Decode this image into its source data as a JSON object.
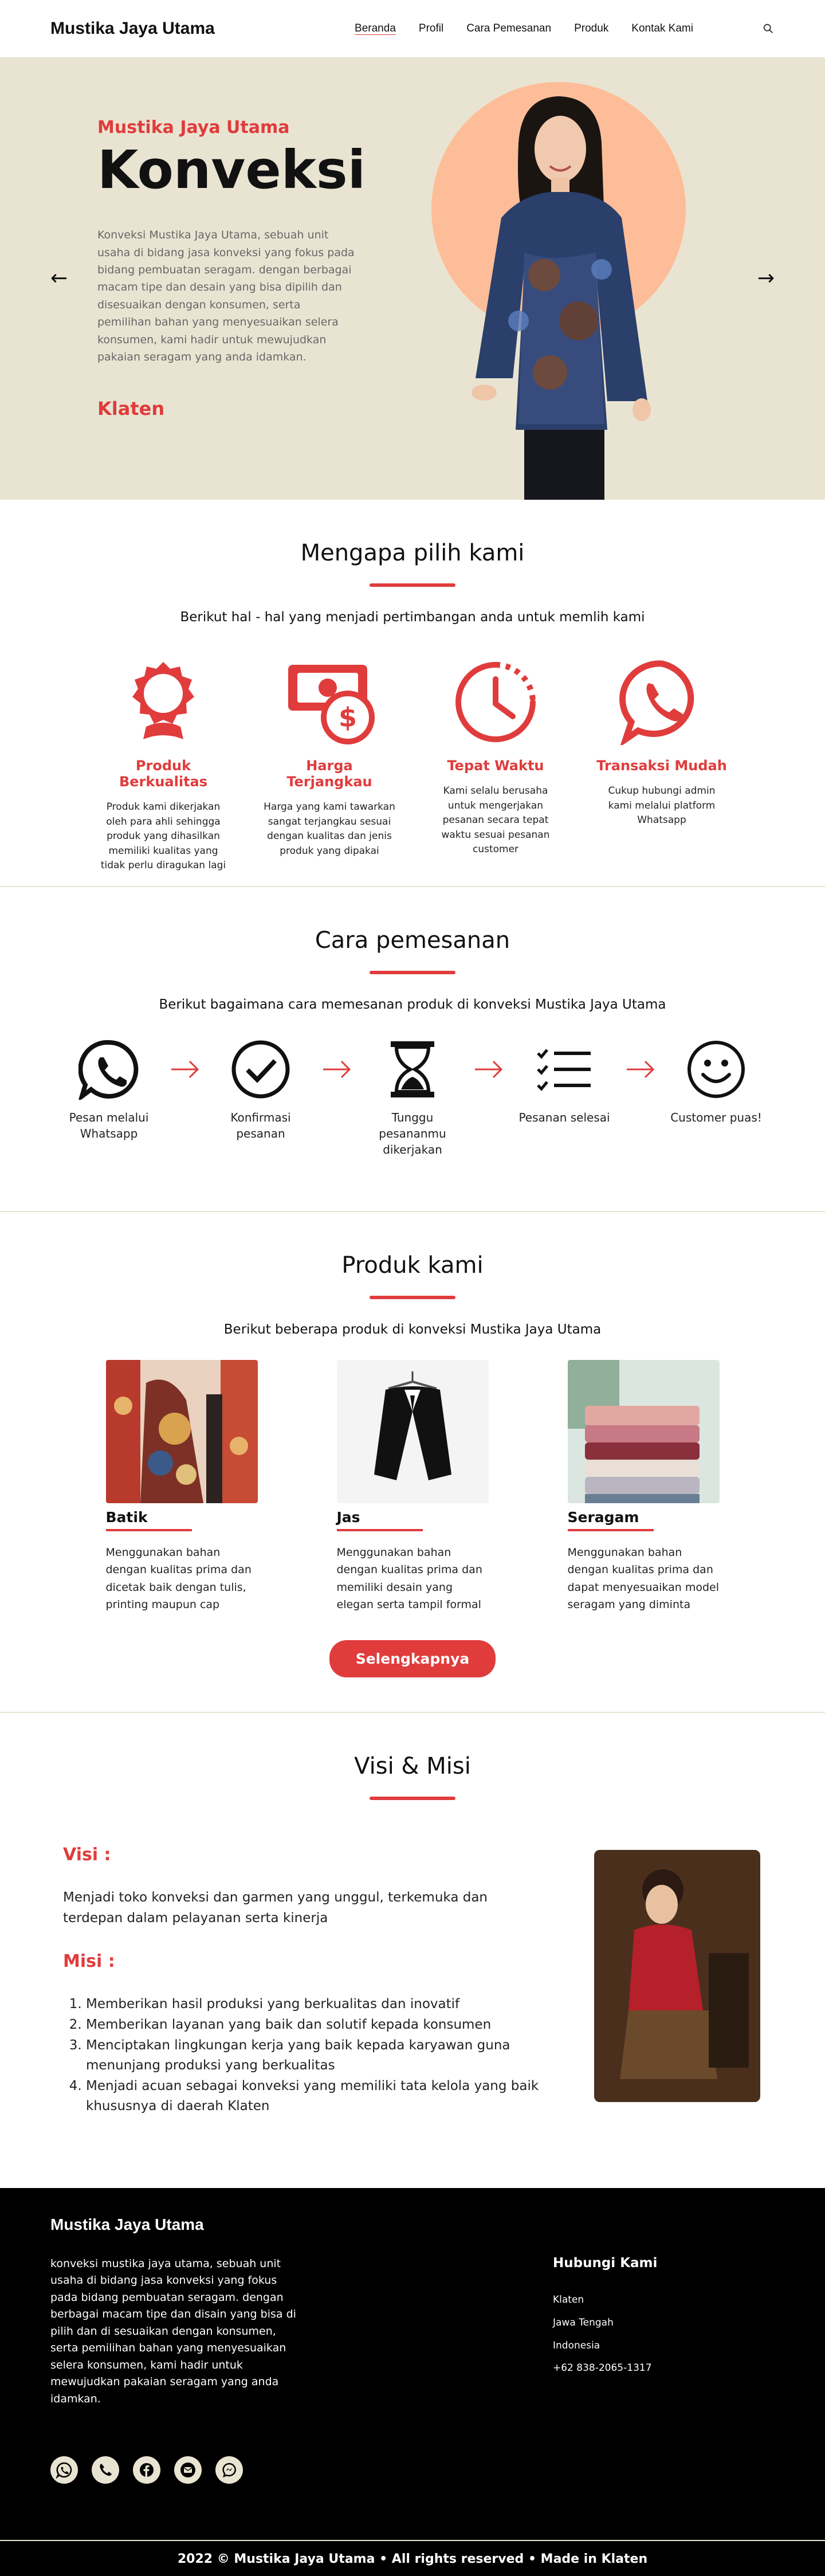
{
  "nav": {
    "brand": "Mustika Jaya Utama",
    "links": [
      "Beranda",
      "Profil",
      "Cara Pemesanan",
      "Produk",
      "Kontak Kami"
    ],
    "search_icon": "search-icon"
  },
  "hero": {
    "subtitle": "Mustika Jaya Utama",
    "title": "Konveksi",
    "description": "Konveksi Mustika Jaya Utama, sebuah unit usaha di bidang jasa konveksi yang fokus pada bidang pembuatan seragam. dengan berbagai macam tipe dan desain yang bisa dipilih dan disesuaikan dengan konsumen, serta pemilihan bahan yang  menyesuaikan selera konsumen, kami hadir untuk mewujudkan pakaian seragam yang anda idamkan.",
    "location": "Klaten",
    "prev_icon": "arrow-left-icon",
    "next_icon": "arrow-right-icon"
  },
  "why": {
    "title": "Mengapa pilih kami",
    "lead": "Berikut hal - hal yang menjadi pertimbangan anda untuk memlih kami",
    "items": [
      {
        "title": "Produk Berkualitas",
        "desc": "Produk kami dikerjakan oleh para ahli sehingga produk yang dihasilkan memiliki kualitas yang tidak perlu diragukan lagi",
        "icon": "award-icon"
      },
      {
        "title": "Harga Terjangkau",
        "desc": "Harga yang kami tawarkan sangat terjangkau sesuai dengan kualitas dan jenis produk yang dipakai",
        "icon": "money-icon"
      },
      {
        "title": "Tepat Waktu",
        "desc": "Kami selalu berusaha untuk mengerjakan pesanan secara tepat waktu sesuai pesanan customer",
        "icon": "clock-icon"
      },
      {
        "title": "Transaksi Mudah",
        "desc": "Cukup hubungi admin kami melalui platform Whatsapp",
        "icon": "phone-bubble-icon"
      }
    ]
  },
  "order": {
    "title": "Cara pemesanan",
    "lead": "Berikut bagaimana cara memesanan produk di konveksi Mustika Jaya Utama",
    "steps": [
      {
        "label": "Pesan melalui Whatsapp",
        "icon": "whatsapp-icon"
      },
      {
        "label": "Konfirmasi pesanan",
        "icon": "check-circle-icon"
      },
      {
        "label": "Tunggu pesananmu dikerjakan",
        "icon": "hourglass-icon"
      },
      {
        "label": "Pesanan selesai",
        "icon": "checklist-icon"
      },
      {
        "label": "Customer puas!",
        "icon": "smile-icon"
      }
    ]
  },
  "products": {
    "title": "Produk kami",
    "lead": "Berikut beberapa produk di konveksi Mustika Jaya Utama",
    "items": [
      {
        "name": "Batik",
        "desc": "Menggunakan bahan dengan kualitas prima dan dicetak baik dengan tulis, printing maupun cap"
      },
      {
        "name": "Jas",
        "desc": "Menggunakan bahan dengan kualitas prima dan memiliki desain yang elegan serta tampil formal"
      },
      {
        "name": "Seragam",
        "desc": "Menggunakan bahan dengan kualitas prima dan dapat menyesuaikan model seragam yang diminta"
      }
    ],
    "button": "Selengkapnya"
  },
  "visi": {
    "title": "Visi & Misi",
    "visi_heading": "Visi :",
    "visi_text": "Menjadi toko konveksi dan garmen yang unggul, terkemuka dan terdepan dalam pelayanan serta kinerja",
    "misi_heading": "Misi :",
    "misi": [
      "Memberikan hasil produksi yang berkualitas dan inovatif",
      "Memberikan layanan yang baik dan solutif kepada konsumen",
      "Menciptakan lingkungan kerja yang baik kepada karyawan guna menunjang produksi yang berkualitas",
      "Menjadi acuan sebagai konveksi yang memiliki tata kelola yang baik khususnya di daerah Klaten"
    ]
  },
  "footer": {
    "brand": "Mustika Jaya Utama",
    "desc": "konveksi mustika jaya utama, sebuah unit usaha di bidang jasa konveksi yang fokus pada bidang pembuatan seragam. dengan berbagai macam tipe dan disain yang bisa di pilih dan di sesuaikan dengan konsumen, serta pemilihan bahan yang menyesuaikan selera konsumen, kami hadir untuk mewujudkan pakaian seragam yang anda idamkan.",
    "contact_title": "Hubungi Kami",
    "contact": [
      "Klaten",
      "Jawa Tengah",
      "Indonesia",
      "+62 838-2065-1317"
    ],
    "social": [
      "whatsapp-icon",
      "phone-icon",
      "facebook-icon",
      "mail-icon",
      "messenger-icon"
    ],
    "copyright": "2022  ©  Mustika Jaya Utama • All rights reserved • Made in Klaten"
  },
  "colors": {
    "accent": "#e03c3c",
    "hero_bg": "#e9e4d2",
    "footer_bg": "#000000"
  }
}
